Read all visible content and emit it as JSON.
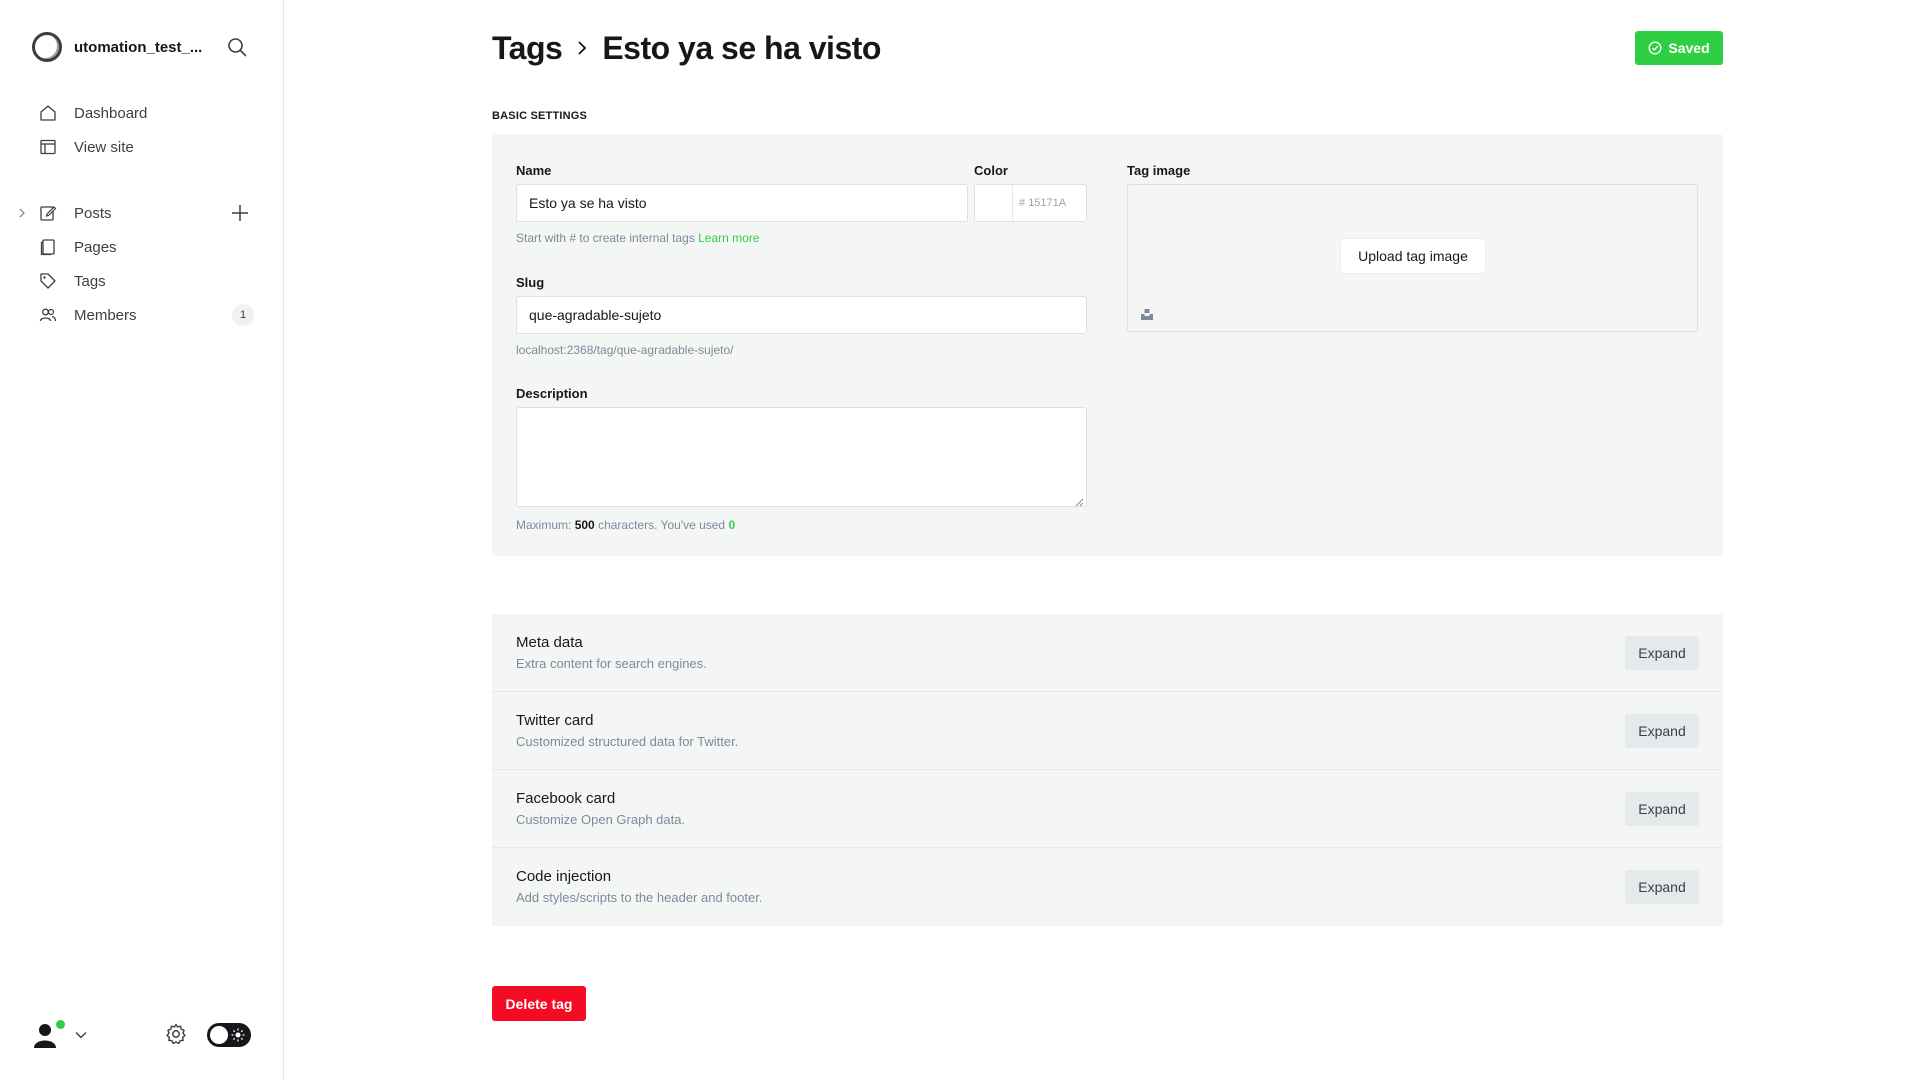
{
  "site": {
    "title": "utomation_test_..."
  },
  "nav": {
    "dashboard": "Dashboard",
    "view_site": "View site",
    "posts": "Posts",
    "pages": "Pages",
    "tags": "Tags",
    "members": "Members",
    "members_count": "1"
  },
  "header": {
    "parent": "Tags",
    "current": "Esto ya se ha visto",
    "saved_label": "Saved"
  },
  "basic_settings": {
    "section_label": "Basic settings",
    "name_label": "Name",
    "name_value": "Esto ya se ha visto",
    "name_hint": "Start with # to create internal tags",
    "learn_more": "Learn more",
    "color_label": "Color",
    "color_hash": "#",
    "color_placeholder": "15171A",
    "slug_label": "Slug",
    "slug_value": "que-agradable-sujeto",
    "slug_url": "localhost:2368/tag/que-agradable-sujeto/",
    "description_label": "Description",
    "desc_hint_prefix": "Maximum:",
    "desc_max": "500",
    "desc_hint_mid": "characters. You've used",
    "desc_used": "0",
    "tag_image_label": "Tag image",
    "upload_label": "Upload tag image"
  },
  "sections": [
    {
      "title": "Meta data",
      "description": "Extra content for search engines.",
      "button": "Expand"
    },
    {
      "title": "Twitter card",
      "description": "Customized structured data for Twitter.",
      "button": "Expand"
    },
    {
      "title": "Facebook card",
      "description": "Customize Open Graph data.",
      "button": "Expand"
    },
    {
      "title": "Code injection",
      "description": "Add styles/scripts to the header and footer.",
      "button": "Expand"
    }
  ],
  "delete_label": "Delete tag",
  "colors": {
    "accent": "#30cf43",
    "danger": "#f50b23",
    "card_bg": "#f4f5f5",
    "text": "#15171a"
  },
  "icons": {
    "search": "search-icon",
    "home": "home-icon",
    "view_site": "browser-icon",
    "posts": "edit-icon",
    "pages": "page-icon",
    "tags": "tag-icon",
    "members": "members-icon",
    "settings": "gear-icon"
  }
}
